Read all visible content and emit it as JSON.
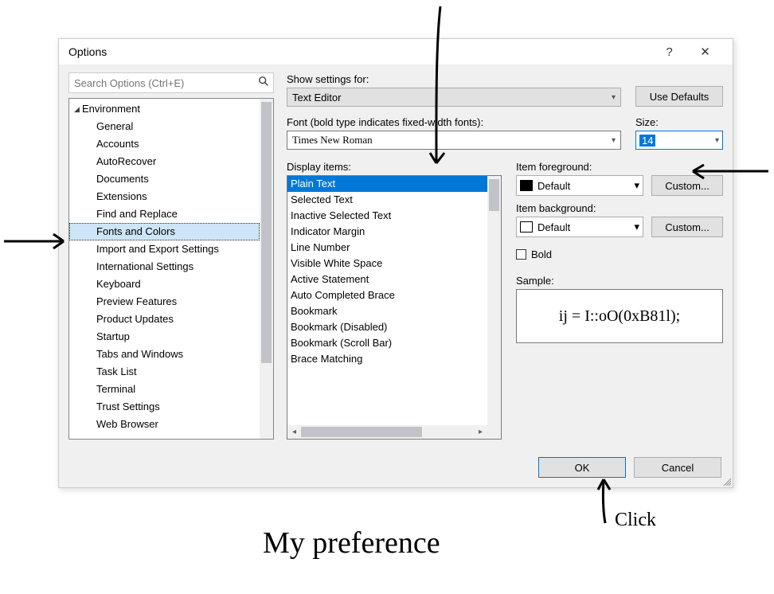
{
  "title": "Options",
  "search_placeholder": "Search Options (Ctrl+E)",
  "tree": {
    "root": "Environment",
    "items": [
      "General",
      "Accounts",
      "AutoRecover",
      "Documents",
      "Extensions",
      "Find and Replace",
      "Fonts and Colors",
      "Import and Export Settings",
      "International Settings",
      "Keyboard",
      "Preview Features",
      "Product Updates",
      "Startup",
      "Tabs and Windows",
      "Task List",
      "Terminal",
      "Trust Settings",
      "Web Browser"
    ],
    "selected_index": 6
  },
  "show_settings_label": "Show settings for:",
  "show_settings_value": "Text Editor",
  "use_defaults_label": "Use Defaults",
  "font_label": "Font (bold type indicates fixed-width fonts):",
  "font_value": "Times New Roman",
  "size_label": "Size:",
  "size_value": "14",
  "display_items_label": "Display items:",
  "display_items": [
    "Plain Text",
    "Selected Text",
    "Inactive Selected Text",
    "Indicator Margin",
    "Line Number",
    "Visible White Space",
    "Active Statement",
    "Auto Completed Brace",
    "Bookmark",
    "Bookmark (Disabled)",
    "Bookmark (Scroll Bar)",
    "Brace Matching"
  ],
  "display_selected_index": 0,
  "fg_label": "Item foreground:",
  "fg_value": "Default",
  "bg_label": "Item background:",
  "bg_value": "Default",
  "custom_label": "Custom...",
  "bold_label": "Bold",
  "sample_label": "Sample:",
  "sample_text": "ij = I::oO(0xB81l);",
  "ok_label": "OK",
  "cancel_label": "Cancel",
  "anno_click": "Click",
  "anno_pref": "My preference"
}
